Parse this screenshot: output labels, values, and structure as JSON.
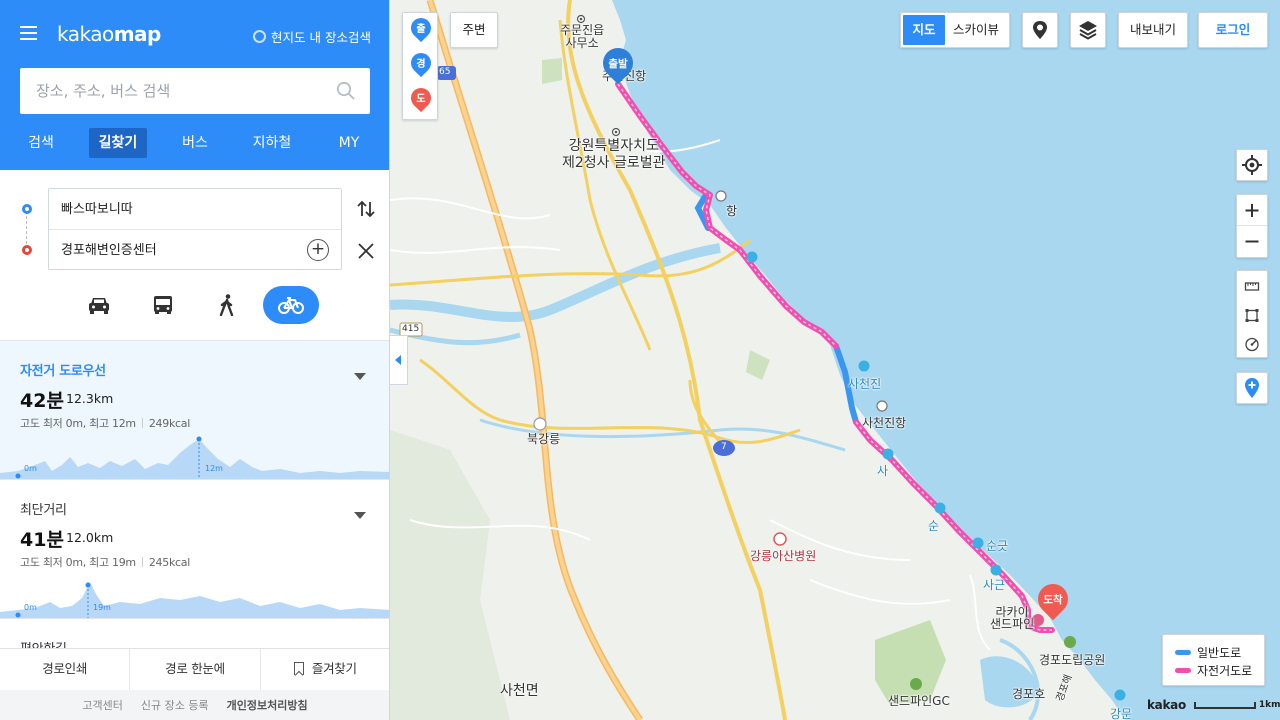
{
  "header": {
    "logo_light": "kakao",
    "logo_bold": "map",
    "local_search_label": "현지도 내 장소검색",
    "search_placeholder": "장소, 주소, 버스 검색",
    "tabs": [
      "검색",
      "길찾기",
      "버스",
      "지하철",
      "MY"
    ],
    "active_tab": "길찾기"
  },
  "route": {
    "start": "빠스따보니따",
    "destination": "경포해변인증센터",
    "modes": [
      "car-icon",
      "bus-icon",
      "walk-icon",
      "bike-icon"
    ],
    "active_mode": "bike"
  },
  "results": [
    {
      "title": "자전거 도로우선",
      "time": "42분",
      "distance": "12.3km",
      "elevation": "고도 최저 0m, 최고 12m",
      "calories": "249kcal",
      "profile_min_label": "0m",
      "profile_max_label": "12m",
      "selected": true
    },
    {
      "title": "최단거리",
      "time": "41분",
      "distance": "12.0km",
      "elevation": "고도 최저 0m, 최고 19m",
      "calories": "245kcal",
      "profile_min_label": "0m",
      "profile_max_label": "19m",
      "selected": false
    },
    {
      "title": "편안한길"
    }
  ],
  "panel_actions": [
    "경로인쇄",
    "경로 한눈에",
    "즐겨찾기"
  ],
  "footer_links": [
    "고객센터",
    "신규 장소 등록",
    "개인정보처리방침"
  ],
  "map": {
    "pin_stack": [
      "출",
      "경",
      "도"
    ],
    "nearby": "주변",
    "map_types": [
      "지도",
      "스카이뷰"
    ],
    "active_map_type": "지도",
    "export": "내보내기",
    "login": "로그인",
    "start_marker": "출발",
    "end_marker": "도착",
    "legend": [
      {
        "label": "일반도로",
        "color": "#3a97f0"
      },
      {
        "label": "자전거도로",
        "color": "#f04fb0"
      }
    ],
    "scale_logo": "kakao",
    "scale_label": "1km",
    "road_shields": [
      "65",
      "415",
      "7"
    ],
    "labels": {
      "jumun_office": "주문진읍\n사무소",
      "jumun_port": "주문진항",
      "gov_office": "강원특별자치도\n제2청사 글로벌관",
      "hang": "항",
      "sacheonjin": "사천진",
      "sacheonjin_port": "사천진항",
      "bukgangneung": "북강릉",
      "gangneung_asan": "강릉아산병원",
      "sungut": "순긋",
      "sacheon_myeon": "사천면",
      "sand_pine": "라카이\n샌드파인",
      "gyeongpo_park": "경포도립공원",
      "sandpine_gc": "샌드파인GC",
      "gyeongpo_lake": "경포호",
      "gangmun": "강문",
      "gyeongpo_beach": "경포해",
      "sa": "사",
      "sun": "순",
      "sa2": "사근"
    }
  },
  "colors": {
    "brand_blue": "#2d8cf7",
    "route_pink": "#f04fb0",
    "route_blue": "#3a97f0",
    "sea": "#a8d7ef",
    "destination_red": "#f05a50"
  }
}
